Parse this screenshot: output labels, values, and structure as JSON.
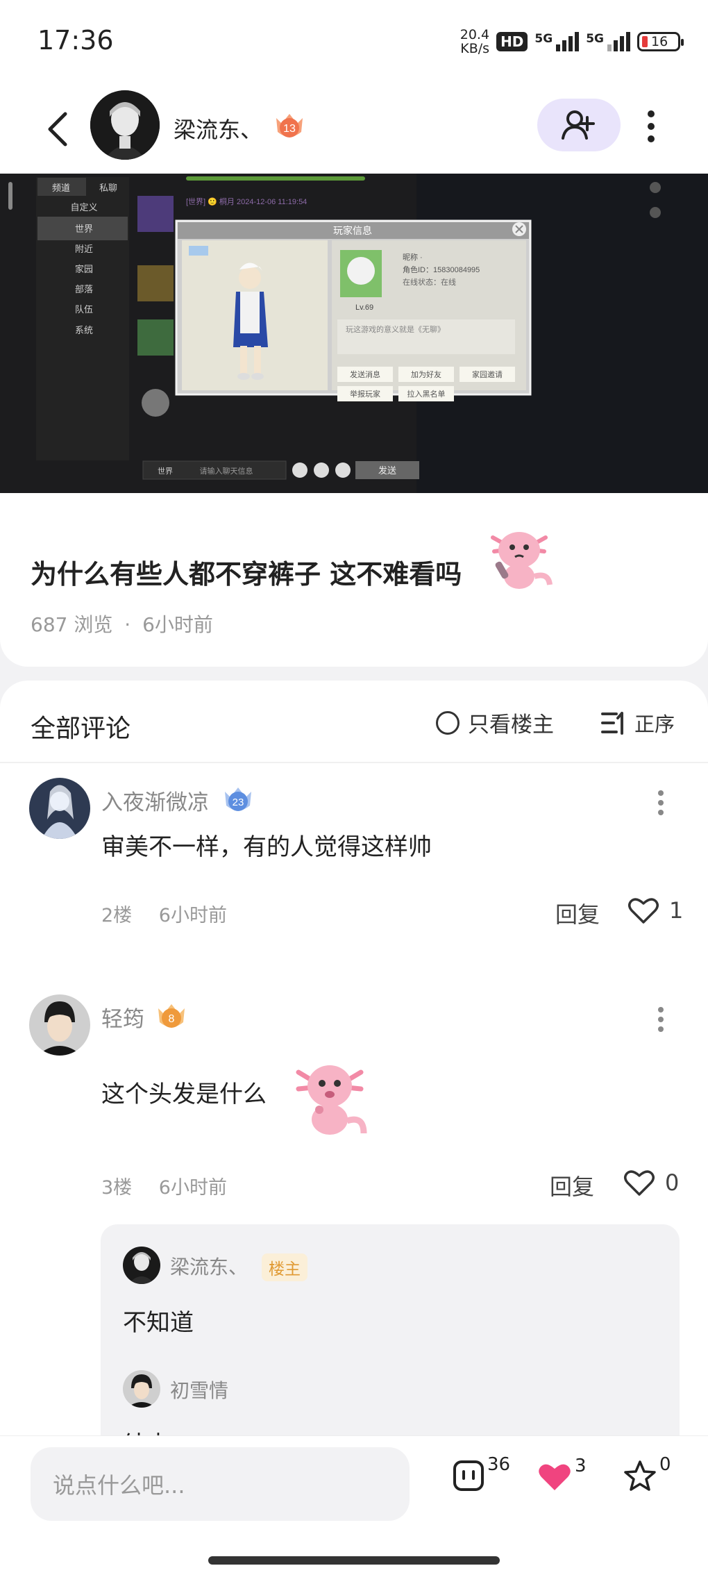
{
  "status_bar": {
    "time": "17:36",
    "net_speed_value": "20.4",
    "net_speed_unit": "KB/s",
    "hd_badge": "HD",
    "signal_1": "5G",
    "signal_2": "5G",
    "battery": "16"
  },
  "header": {
    "author_name": "梁流东、",
    "author_level": "13"
  },
  "game_screenshot": {
    "tab_channel": "频道",
    "tab_private": "私聊",
    "channels": [
      "自定义",
      "世界",
      "附近",
      "家园",
      "部落",
      "队伍",
      "系统"
    ],
    "chat_line": "[世界] 🙂 桐月  2024-12-06  11:19:54",
    "dialog_title": "玩家信息",
    "player_level": "Lv.69",
    "name_line": "昵称 ·",
    "id_line": "角色ID：15830084995",
    "online_line": "在线状态：在线",
    "signature": "玩这游戏的意义就是《无聊》",
    "btn_send": "发送消息",
    "btn_add": "加为好友",
    "btn_home": "家园邀请",
    "btn_report": "举报玩家",
    "btn_block": "拉入黑名单",
    "chat_channel": "世界",
    "chat_placeholder": "请输入聊天信息",
    "chat_send": "发送"
  },
  "post": {
    "title": "为什么有些人都不穿裤子 这不难看吗",
    "views": "687 浏览",
    "separator": "·",
    "time": "6小时前"
  },
  "comments_section": {
    "title": "全部评论",
    "only_host": "只看楼主",
    "sort": "正序"
  },
  "comments": [
    {
      "name": "入夜渐微凉",
      "level": "23",
      "text": "审美不一样，有的人觉得这样帅",
      "floor": "2楼",
      "time": "6小时前",
      "reply": "回复",
      "likes": "1"
    },
    {
      "name": "轻筠",
      "level": "8",
      "text": "这个头发是什么",
      "floor": "3楼",
      "time": "6小时前",
      "reply": "回复",
      "likes": "0"
    }
  ],
  "sub_replies": [
    {
      "name": "梁流东、",
      "tag": "楼主",
      "text": "不知道"
    },
    {
      "name": "初雪情",
      "text": "结束"
    }
  ],
  "bottom_bar": {
    "input_placeholder": "说点什么吧...",
    "comment_count": "36",
    "like_count": "3",
    "fav_count": "0"
  },
  "colors": {
    "accent_purple": "#e9e4fb",
    "like_pink": "#f0447f",
    "host_tag": "#e09a33"
  }
}
